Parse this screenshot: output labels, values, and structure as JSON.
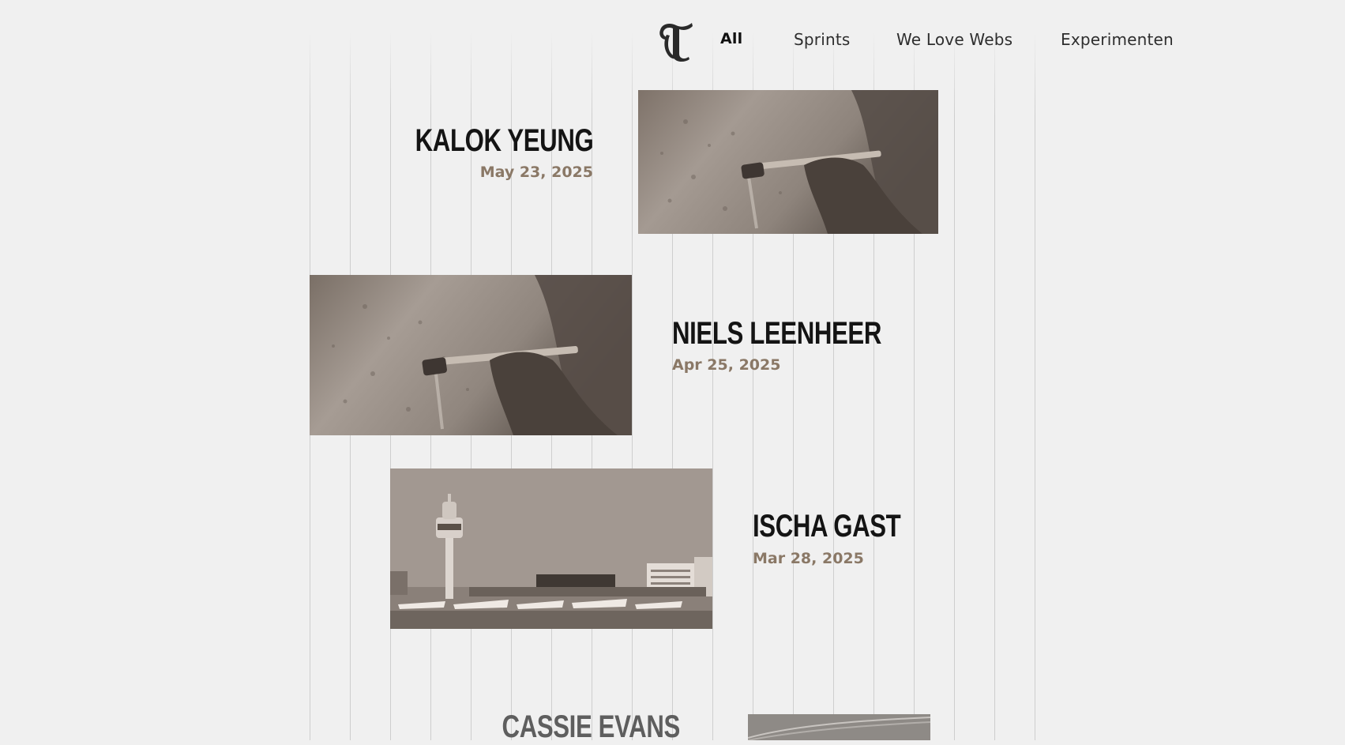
{
  "logo": {
    "icon": "blackletter-t-logo",
    "letter": "T"
  },
  "nav": {
    "items": [
      {
        "label": "All",
        "active": true
      },
      {
        "label": "Sprints",
        "active": false
      },
      {
        "label": "We Love Webs",
        "active": false
      },
      {
        "label": "Experimenten",
        "active": false
      }
    ]
  },
  "posts": [
    {
      "name": "KALOK YEUNG",
      "date": "May 23, 2025",
      "image": "sepia-photo-paintbrush-on-textured-wall"
    },
    {
      "name": "NIELS LEENHEER",
      "date": "Apr 25, 2025",
      "image": "sepia-photo-paintbrush-on-textured-wall"
    },
    {
      "name": "ISCHA GAST",
      "date": "Mar 28, 2025",
      "image": "sepia-photo-schiphol-airport-control-tower"
    },
    {
      "name": "CASSIE EVANS",
      "date": "",
      "image": "sepia-photo-highway-night"
    }
  ],
  "colors": {
    "background": "#f0f0f0",
    "heading": "#141414",
    "date": "#8a7866",
    "sepia_dark": "#5a5048",
    "sepia_light": "#a89e96"
  }
}
